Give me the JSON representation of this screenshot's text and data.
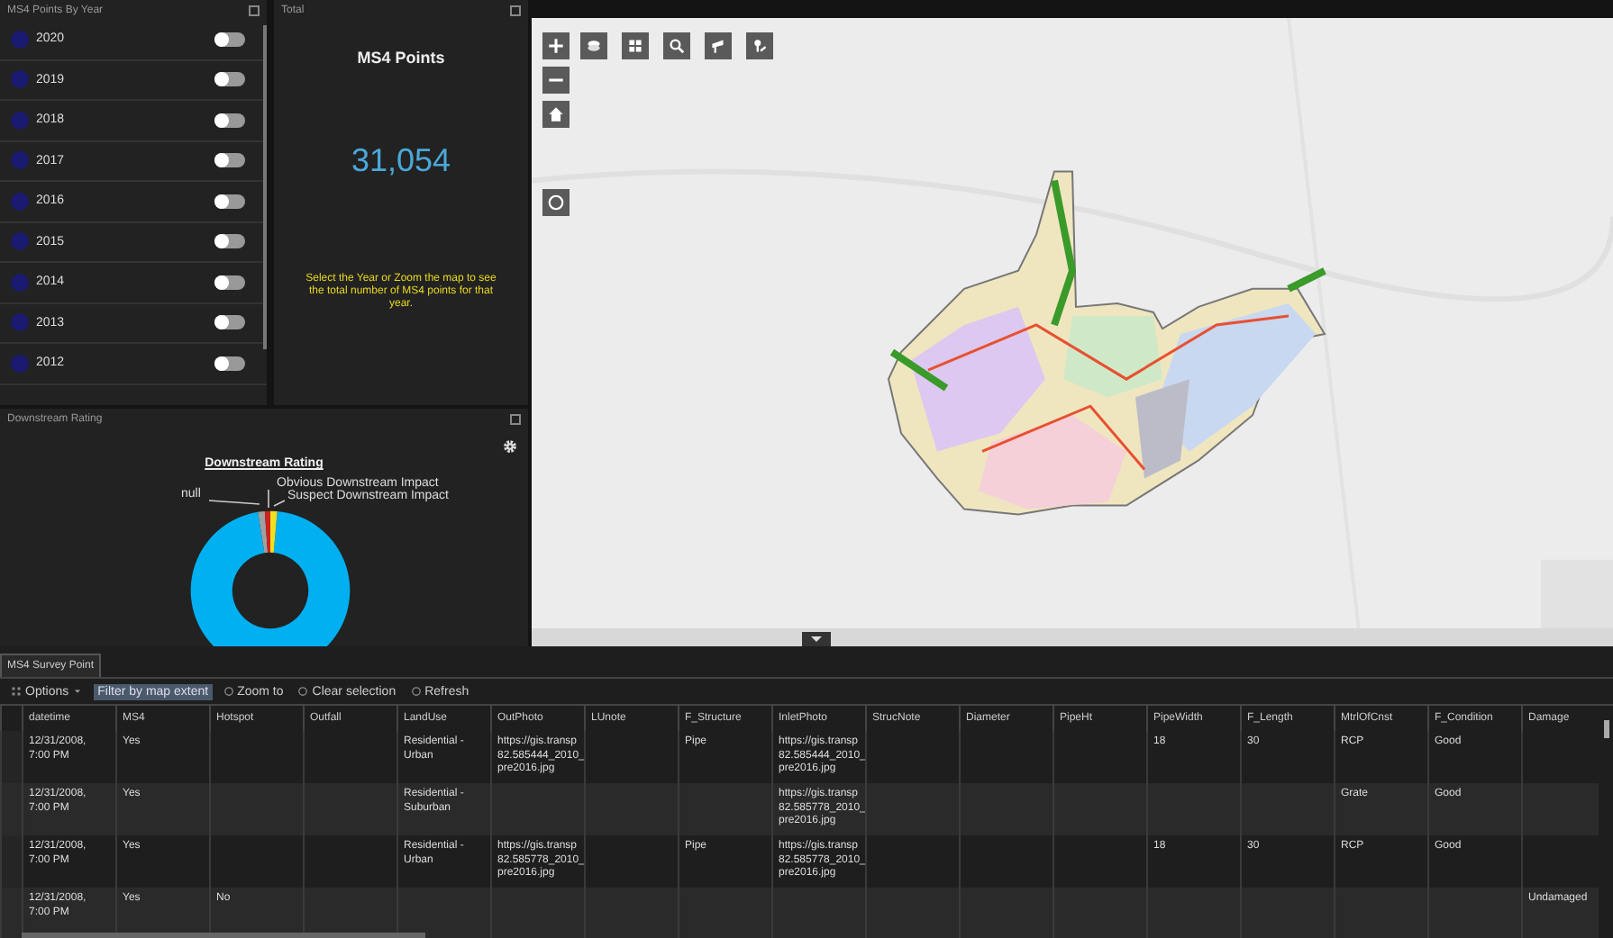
{
  "years_panel": {
    "title": "MS4 Points By Year",
    "items": [
      {
        "label": "2020",
        "on": false
      },
      {
        "label": "2019",
        "on": false
      },
      {
        "label": "2018",
        "on": false
      },
      {
        "label": "2017",
        "on": false
      },
      {
        "label": "2016",
        "on": false
      },
      {
        "label": "2015",
        "on": false
      },
      {
        "label": "2014",
        "on": false
      },
      {
        "label": "2013",
        "on": false
      },
      {
        "label": "2012",
        "on": false
      }
    ]
  },
  "total_panel": {
    "title": "Total",
    "heading": "MS4 Points",
    "value": "31,054",
    "note": "Select the Year or Zoom the map to see the total number of MS4 points for that year."
  },
  "downstream_panel": {
    "title": "Downstream Rating",
    "chart_title": "Downstream Rating",
    "slices": [
      {
        "label": "null",
        "color": "#a0a0a0"
      },
      {
        "label": "Obvious Downstream Impact",
        "color": "#d02020"
      },
      {
        "label": "Suspect Downstream Impact",
        "color": "#f0e020"
      }
    ]
  },
  "survey_panel": {
    "tab": "MS4 Survey Point",
    "toolbar": [
      {
        "kind": "menu",
        "label": "Options",
        "selected": false
      },
      {
        "kind": "toggle",
        "label": "Filter by map extent",
        "selected": true
      },
      {
        "kind": "action",
        "label": "Zoom to",
        "selected": false
      },
      {
        "kind": "action",
        "label": "Clear selection",
        "selected": false
      },
      {
        "kind": "action",
        "label": "Refresh",
        "selected": false
      }
    ],
    "table": {
      "columns": [
        "datetime",
        "MS4",
        "Hotspot",
        "Outfall",
        "LandUse",
        "OutPhoto",
        "LUnote",
        "F_Structure",
        "InletPhoto",
        "StrucNote",
        "Diameter",
        "PipeHt",
        "PipeWidth",
        "F_Length",
        "MtrlOfCnst",
        "F_Condition",
        "Damage"
      ],
      "rows": [
        [
          "12/31/2008, 7:00 PM",
          "Yes",
          null,
          null,
          "Residential - Urban",
          "https://gis.transp\n82.585444_2010_\npre2016.jpg",
          null,
          "Pipe",
          "https://gis.transp\n82.585444_2010_\npre2016.jpg",
          null,
          null,
          null,
          "18",
          "30",
          "RCP",
          "Good",
          null
        ],
        [
          "12/31/2008, 7:00 PM",
          "Yes",
          null,
          null,
          "Residential - Suburban",
          null,
          null,
          null,
          "https://gis.transp\n82.585778_2010_\npre2016.jpg",
          null,
          null,
          null,
          null,
          null,
          "Grate",
          "Good",
          null
        ],
        [
          "12/31/2008, 7:00 PM",
          "Yes",
          null,
          null,
          "Residential - Urban",
          "https://gis.transp\n82.585778_2010_\npre2016.jpg",
          null,
          "Pipe",
          "https://gis.transp\n82.585778_2010_\npre2016.jpg",
          null,
          null,
          null,
          "18",
          "30",
          "RCP",
          "Good",
          null
        ],
        [
          "12/31/2008, 7:00 PM",
          "Yes",
          "No",
          null,
          null,
          null,
          null,
          null,
          null,
          null,
          null,
          null,
          null,
          null,
          null,
          null,
          "Undamaged"
        ]
      ]
    }
  }
}
